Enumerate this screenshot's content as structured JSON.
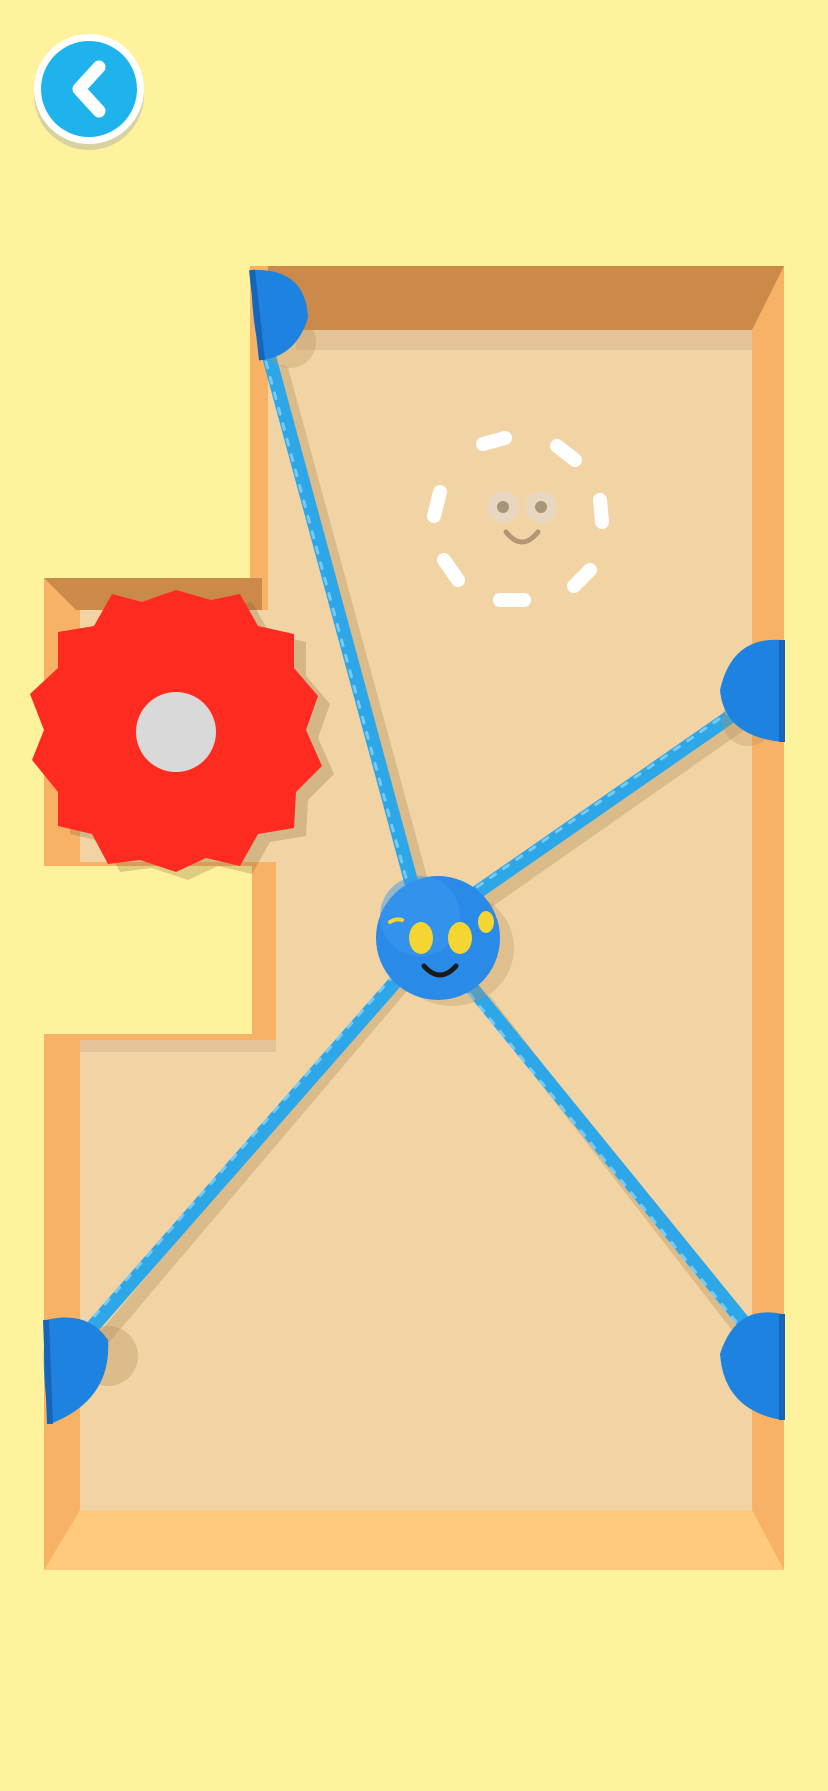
{
  "app": {
    "screen": "rope-rescue-level"
  },
  "header": {
    "back_button": {
      "icon": "chevron-left-icon"
    }
  },
  "colors": {
    "background": "#FFF29C",
    "board_floor": "#F2D4A4",
    "wall_light": "#F7B265",
    "wall_dark": "#CC8A4A",
    "rope": "#2EA7E8",
    "anchor": "#1E82E0",
    "hero": "#2A8AE8",
    "hero_eyes": "#F5D531",
    "saw": "#FF2A20",
    "saw_hub": "#D9D9D9",
    "goal_marker": "#FFFFFF",
    "back_button": "#1FB3EE"
  },
  "game": {
    "hero": {
      "name": "blue-ball-character",
      "expression": "smile"
    },
    "ropes": [
      {
        "name": "rope-top-left",
        "anchor": "anchor-top-left"
      },
      {
        "name": "rope-right",
        "anchor": "anchor-right"
      },
      {
        "name": "rope-bottom-left",
        "anchor": "anchor-bottom-left"
      },
      {
        "name": "rope-bottom-right",
        "anchor": "anchor-bottom-right"
      }
    ],
    "hazards": [
      {
        "type": "spinning-saw",
        "color": "red"
      }
    ],
    "goal": {
      "type": "dashed-circle-face-target"
    }
  }
}
